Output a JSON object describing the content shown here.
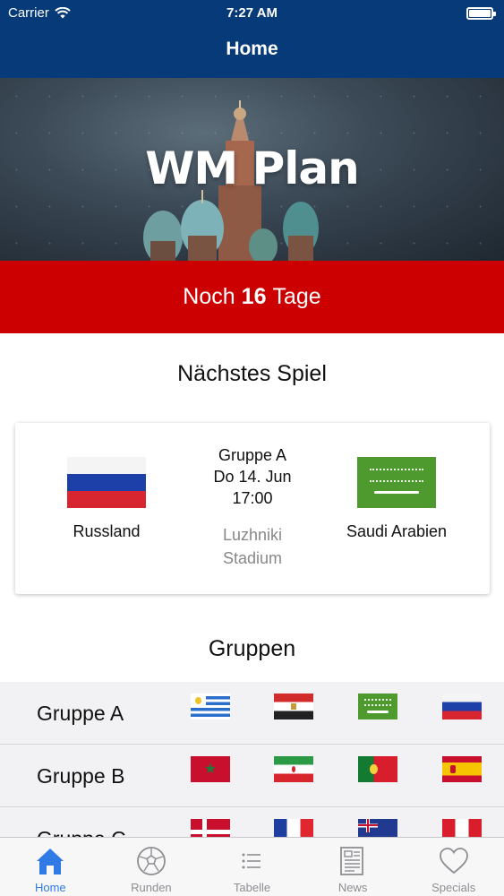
{
  "status_bar": {
    "carrier": "Carrier",
    "time": "7:27 AM"
  },
  "nav": {
    "title": "Home"
  },
  "hero": {
    "title": "WM Plan"
  },
  "countdown": {
    "prefix": "Noch",
    "days": "16",
    "suffix": "Tage"
  },
  "next_match": {
    "section_title": "Nächstes Spiel",
    "home_team": {
      "name": "Russland",
      "flag": "russia-flag"
    },
    "away_team": {
      "name": "Saudi Arabien",
      "flag": "saudi-arabia-flag"
    },
    "group": "Gruppe A",
    "date": "Do 14. Jun",
    "time": "17:00",
    "venue_line1": "Luzhniki",
    "venue_line2": "Stadium"
  },
  "groups": {
    "section_title": "Gruppen",
    "rows": [
      {
        "name": "Gruppe A",
        "flags": [
          "uruguay-flag",
          "egypt-flag",
          "saudi-arabia-flag",
          "russia-flag"
        ]
      },
      {
        "name": "Gruppe B",
        "flags": [
          "morocco-flag",
          "iran-flag",
          "portugal-flag",
          "spain-flag"
        ]
      },
      {
        "name": "Gruppe C",
        "flags": [
          "denmark-flag",
          "france-flag",
          "australia-flag",
          "peru-flag"
        ]
      }
    ]
  },
  "tabbar": {
    "active_color": "#2f7ae5",
    "inactive_color": "#8e8e93",
    "items": [
      {
        "label": "Home",
        "icon": "house-icon",
        "active": true
      },
      {
        "label": "Runden",
        "icon": "soccer-ball-icon",
        "active": false
      },
      {
        "label": "Tabelle",
        "icon": "list-icon",
        "active": false
      },
      {
        "label": "News",
        "icon": "newspaper-icon",
        "active": false
      },
      {
        "label": "Specials",
        "icon": "heart-icon",
        "active": false
      }
    ]
  },
  "colors": {
    "nav_blue": "#073a78",
    "countdown_red": "#cc0000"
  }
}
